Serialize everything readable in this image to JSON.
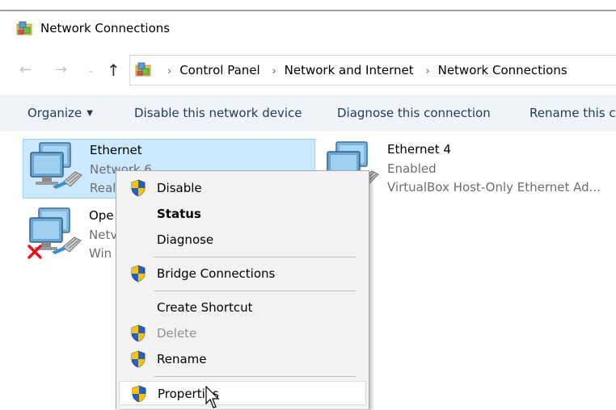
{
  "window": {
    "title": "Network Connections"
  },
  "nav": {
    "back_glyph": "←",
    "forward_glyph": "→",
    "down_glyph": "⌄",
    "up_glyph": "↑",
    "breadcrumbs": [
      "Control Panel",
      "Network and Internet",
      "Network Connections"
    ],
    "separator": "›"
  },
  "toolbar": {
    "organize": "Organize",
    "organize_caret": "▼",
    "disable": "Disable this network device",
    "diagnose": "Diagnose this connection",
    "rename": "Rename this c"
  },
  "connections": [
    {
      "name": "Ethernet",
      "line2": "Network 6",
      "line3": "Real",
      "selected": true
    },
    {
      "name": "Ethernet 4",
      "line2": "Enabled",
      "line3": "VirtualBox Host-Only Ethernet Ad..."
    },
    {
      "name": "Ope",
      "line2": "Netv",
      "line3": "Win",
      "disconnected": true
    }
  ],
  "context_menu": [
    {
      "label": "Disable",
      "shield": true
    },
    {
      "label": "Status",
      "bold": true
    },
    {
      "label": "Diagnose"
    },
    {
      "label": "Bridge Connections",
      "shield": true
    },
    {
      "label": "Create Shortcut"
    },
    {
      "label": "Delete",
      "shield": true,
      "disabled": true
    },
    {
      "label": "Rename",
      "shield": true
    },
    {
      "label": "Properties",
      "shield": true,
      "hovered": true
    }
  ],
  "colors": {
    "selection_bg": "#cce8ff",
    "selection_border": "#99d1ff",
    "toolbar_bg": "#f0f3f8",
    "toolbar_text": "#1e3b5c",
    "menu_bg": "#f2f2f2",
    "shield_blue": "#2b5fbe",
    "shield_yellow": "#f6c500",
    "disconnected_x": "#e81123"
  },
  "icons": {
    "title": "network-connections-icon",
    "address": "network-connections-icon",
    "connection": "network-adapter-icon",
    "shield": "uac-shield-icon",
    "cursor": "mouse-pointer-icon"
  }
}
